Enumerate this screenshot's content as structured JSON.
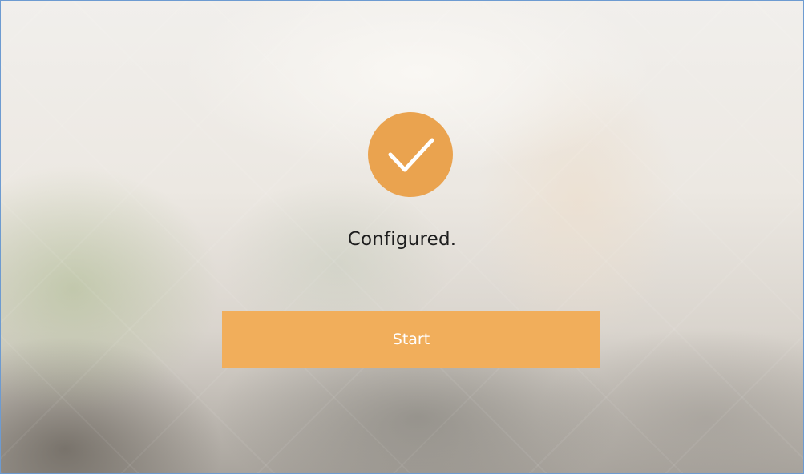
{
  "status": {
    "icon": "checkmark-circle-icon",
    "message": "Configured."
  },
  "actions": {
    "start_label": "Start"
  },
  "colors": {
    "accent": "#eaa34f",
    "button": "#f1ae5b",
    "button_text": "#ffffff",
    "check_stroke": "#ffffff",
    "window_border": "#6d9bd1"
  }
}
